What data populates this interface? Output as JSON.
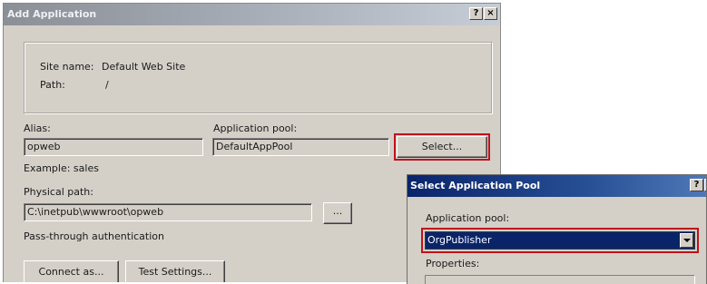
{
  "add_dialog": {
    "title": "Add Application",
    "help_button": "?",
    "close_button": "×",
    "site_name_label": "Site name:",
    "site_name_value": "Default Web Site",
    "path_label": "Path:",
    "path_value": "/",
    "alias_label": "Alias:",
    "alias_value": "opweb",
    "alias_example": "Example: sales",
    "app_pool_label": "Application pool:",
    "app_pool_value": "DefaultAppPool",
    "select_button": "Select...",
    "physical_path_label": "Physical path:",
    "physical_path_value": "C:\\inetpub\\wwwroot\\opweb",
    "browse_button": "...",
    "pass_through_label": "Pass-through authentication",
    "connect_as_button": "Connect as...",
    "test_settings_button": "Test Settings..."
  },
  "pool_dialog": {
    "title": "Select Application Pool",
    "help_button": "?",
    "close_button": "×",
    "app_pool_label": "Application pool:",
    "app_pool_selected": "OrgPublisher",
    "properties_label": "Properties:"
  },
  "colors": {
    "highlight": "#c0121c",
    "active_title": "#0a246a",
    "dialog_face": "#d4d0c8"
  }
}
